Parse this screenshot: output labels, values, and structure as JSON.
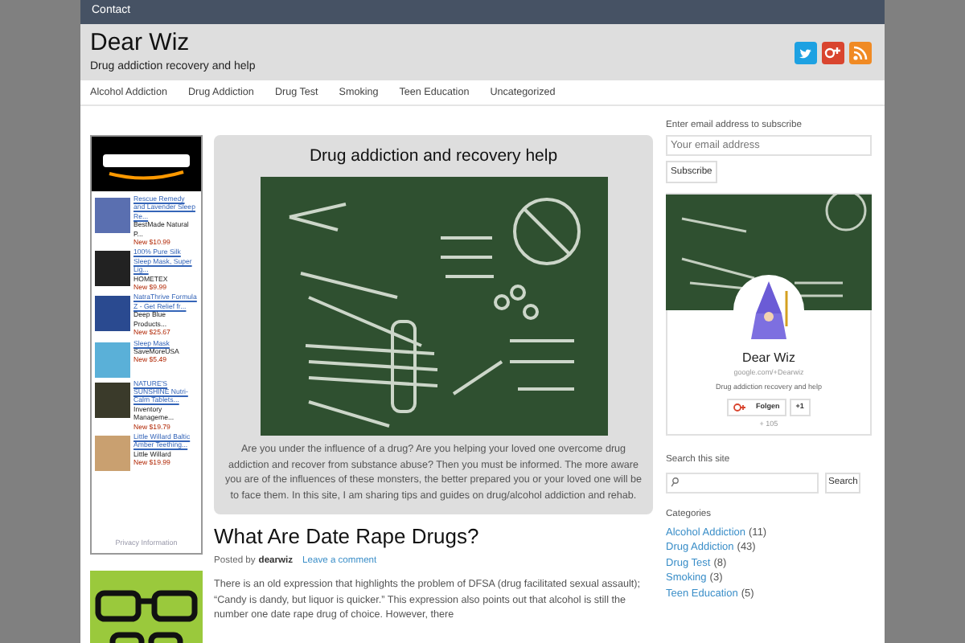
{
  "top_bar": {
    "links": [
      "Contact"
    ]
  },
  "header": {
    "title": "Dear Wiz",
    "tagline": "Drug addiction recovery and help"
  },
  "nav": {
    "items": [
      "Alcohol Addiction",
      "Drug Addiction",
      "Drug Test",
      "Smoking",
      "Teen Education",
      "Uncategorized"
    ]
  },
  "amazon_ad": {
    "products": [
      {
        "title": "Rescue Remedy and Lavender Sleep Re...",
        "seller": "BestMade Natural P...",
        "price": "New $10.99"
      },
      {
        "title": "100% Pure Silk Sleep Mask, Super Lig...",
        "seller": "HOMETEX",
        "price": "New $9.99"
      },
      {
        "title": "NatraThrive Formula Z - Get Relief fr...",
        "seller": "Deep Blue Products...",
        "price": "New $25.67"
      },
      {
        "title": "Sleep Mask",
        "seller": "SaveMoreUSA",
        "price": "New $5.49"
      },
      {
        "title": "NATURE'S SUNSHINE Nutri-Calm Tablets...",
        "seller": "Inventory Manageme...",
        "price": "New $19.79"
      },
      {
        "title": "Little Willard Baltic Amber Teething...",
        "seller": "Little Willard",
        "price": "New $19.99"
      }
    ],
    "privacy": "Privacy Information"
  },
  "hero": {
    "title": "Drug addiction and recovery help",
    "text": "Are you under the influence of a drug? Are you helping your loved one overcome drug addiction and recover from substance abuse? Then you must be informed. The more aware you are of the influences of these monsters, the better prepared you or your loved one will be to face them. In this site, I am sharing tips and guides on drug/alcohol addiction and rehab."
  },
  "post": {
    "title": "What Are Date Rape Drugs?",
    "posted_by": "Posted by",
    "author": "dearwiz",
    "comment_link": "Leave a comment",
    "excerpt": "There is an old expression that highlights the problem of DFSA (drug facilitated sexual assault); “Candy is dandy, but liquor is quicker.” This expression also points out that alcohol is still the number one date rape drug of choice. However, there"
  },
  "subscribe": {
    "label": "Enter email address to subscribe",
    "placeholder": "Your email address",
    "button": "Subscribe"
  },
  "gplus_card": {
    "name": "Dear Wiz",
    "url": "google.com/+Dearwiz",
    "tagline": "Drug addiction recovery and help",
    "follow": "Folgen",
    "plus_one": "+1",
    "count": "+ 105"
  },
  "search": {
    "label": "Search this site",
    "button": "Search"
  },
  "categories": {
    "label": "Categories",
    "items": [
      {
        "name": "Alcohol Addiction",
        "count": "(11)"
      },
      {
        "name": "Drug Addiction",
        "count": "(43)"
      },
      {
        "name": "Drug Test",
        "count": "(8)"
      },
      {
        "name": "Smoking",
        "count": "(3)"
      },
      {
        "name": "Teen Education",
        "count": "(5)"
      }
    ]
  }
}
